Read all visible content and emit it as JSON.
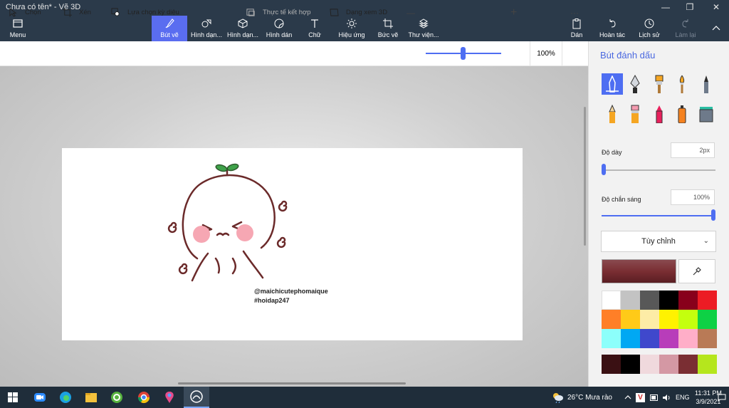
{
  "window": {
    "title": "Chưa có tên* - Vẽ 3D",
    "controls": [
      "—",
      "❐",
      "✕"
    ]
  },
  "ribbon": {
    "menu": "Menu",
    "tools": [
      {
        "label": "Bút vẽ",
        "icon": "brush-icon",
        "active": true
      },
      {
        "label": "Hình dạn...",
        "icon": "2d-shapes-icon"
      },
      {
        "label": "Hình dạn...",
        "icon": "3d-shapes-icon"
      },
      {
        "label": "Hình dán",
        "icon": "stickers-icon"
      },
      {
        "label": "Chữ",
        "icon": "text-icon"
      },
      {
        "label": "Hiệu ứng",
        "icon": "effects-icon"
      },
      {
        "label": "Bức vẽ",
        "icon": "canvas-icon"
      },
      {
        "label": "Thư viện...",
        "icon": "3d-library-icon"
      }
    ],
    "right": [
      {
        "label": "Dán",
        "icon": "paste-icon"
      },
      {
        "label": "Hoàn tác",
        "icon": "undo-icon"
      },
      {
        "label": "Lịch sử",
        "icon": "history-icon"
      },
      {
        "label": "Làm lại",
        "icon": "redo-icon",
        "disabled": true
      }
    ],
    "collapse": "collapse-ribbon-icon"
  },
  "toolbar": {
    "select": "Chọn",
    "crop": "Xén",
    "magic_select": "Lựa chọn kỳ diệu",
    "mixed_reality": "Thực tế kết hợp",
    "view_3d": "Dạng xem 3D",
    "zoom_minus": "—",
    "zoom_plus": "+",
    "zoom": "100%",
    "more": "···",
    "zoom_level": 0.5
  },
  "canvas": {
    "watermark_line1": "@maichicutephomaique",
    "watermark_line2": "#hoidap247"
  },
  "panel": {
    "title": "Bút đánh dấu",
    "brushes": [
      "marker-icon",
      "calligraphy-pen-icon",
      "oil-brush-icon",
      "watercolor-icon",
      "pixel-pen-icon",
      "pencil-icon",
      "eraser-icon",
      "crayon-icon",
      "spray-can-icon",
      "fill-icon"
    ],
    "thickness_label": "Độ dày",
    "thickness_value": "2px",
    "opacity_label": "Độ chắn sáng",
    "opacity_value": "100%",
    "thickness_level": 0.02,
    "opacity_level": 1.0,
    "texture_label": "Tùy chỉnh",
    "current_color": "#7a2e33",
    "palette": [
      "#ffffff",
      "#c3c3c3",
      "#585858",
      "#000000",
      "#88001b",
      "#ec1c24",
      "#ff7f27",
      "#ffca18",
      "#fdeca6",
      "#fff200",
      "#c4ff0e",
      "#0ed145",
      "#8cfffb",
      "#00a8f3",
      "#3f48cc",
      "#b83dba",
      "#ffaec8",
      "#b97a56"
    ],
    "custom_colors": [
      "#3a1013",
      "#000000",
      "#f0d9dd",
      "#d498a4",
      "#7a2e33",
      "#b5e61d"
    ]
  },
  "taskbar": {
    "apps": [
      "windows-start-icon",
      "zoom-icon",
      "edge-icon",
      "file-explorer-icon",
      "360-browser-icon",
      "chrome-icon",
      "maps-pin-icon",
      "paint-3d-icon"
    ],
    "weather": "26°C  Mưa rào",
    "lang": "ENG",
    "time": "11:31 PM",
    "date": "3/9/2021"
  }
}
